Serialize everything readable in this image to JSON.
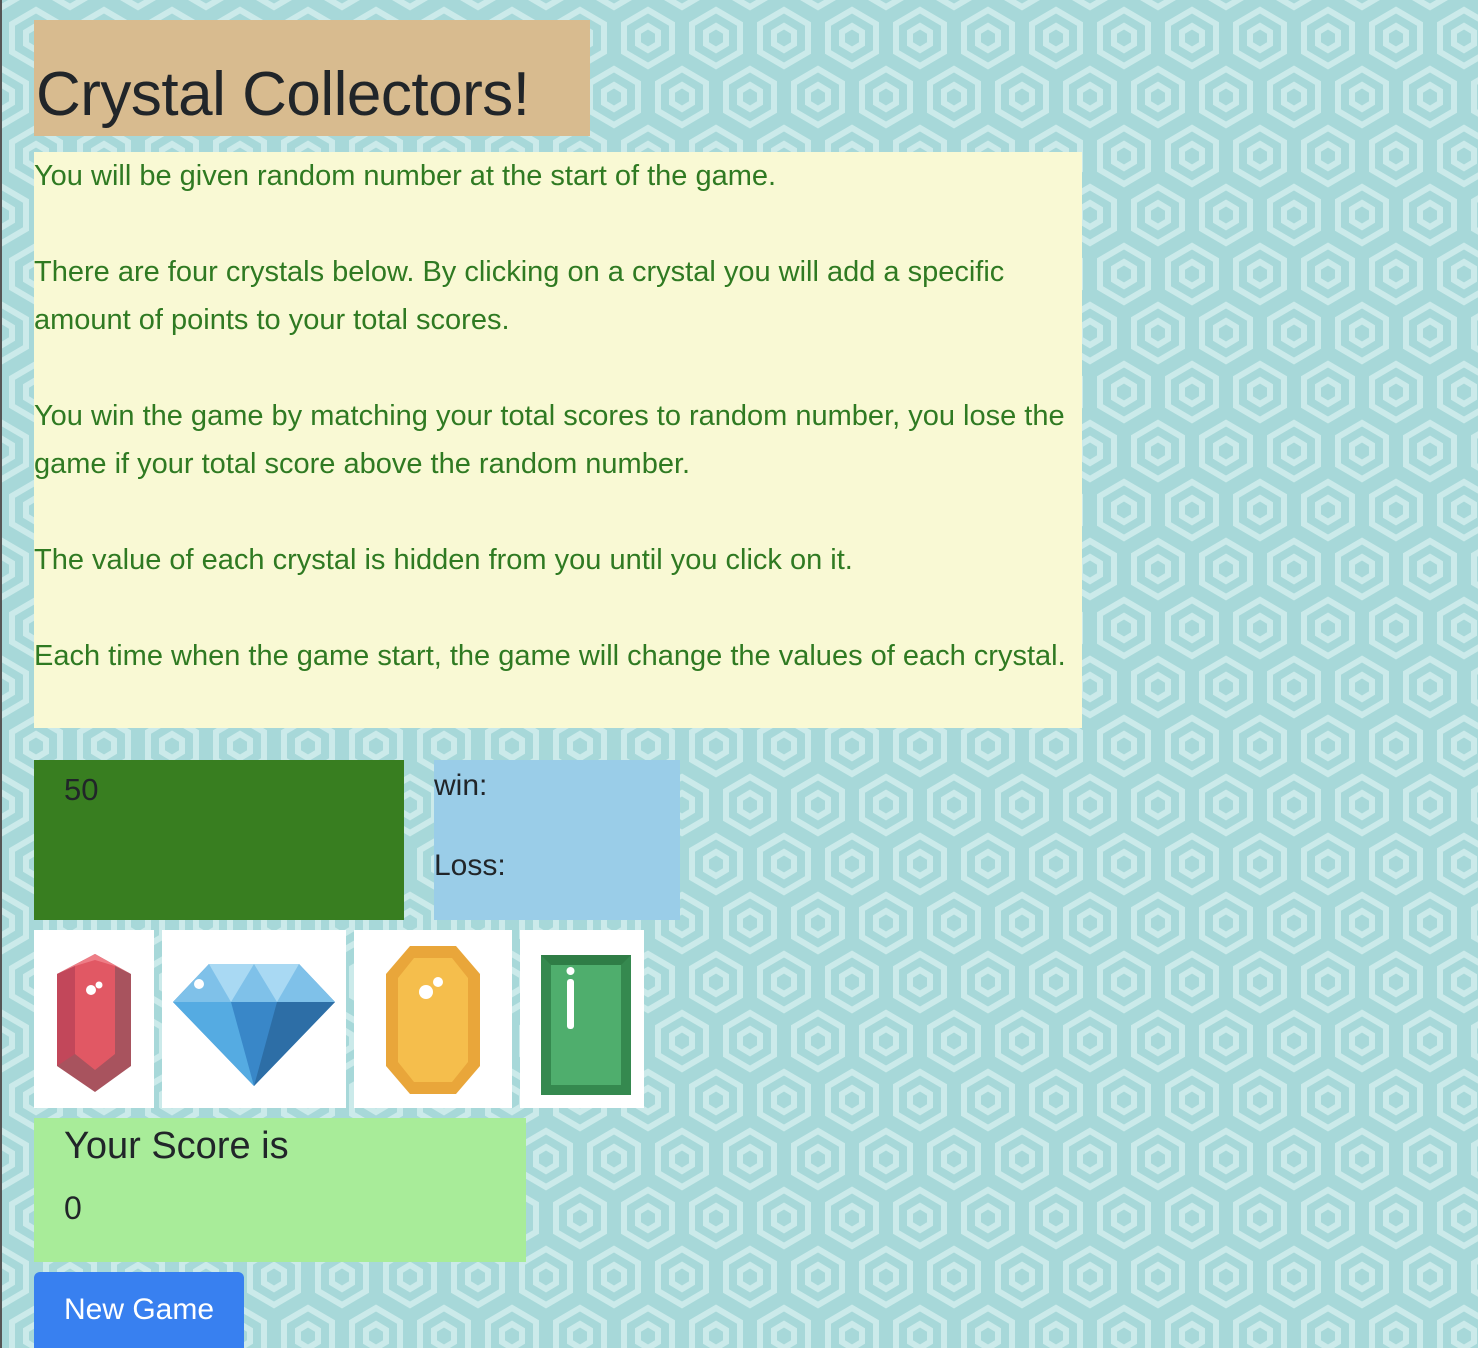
{
  "page": {
    "title": "Crystal Collectors!"
  },
  "instructions": [
    "You will be given random number at the start of the game.",
    "There are four crystals below. By clicking on a crystal you will add a specific amount of points to your total scores.",
    "You win the game by matching your total scores to random number, you lose the game if your total score above the random number.",
    "The value of each crystal is hidden from you until you click on it.",
    "Each time when the game start, the game will change the values of each crystal."
  ],
  "random_number": "50",
  "stats": {
    "win_label": "win:",
    "loss_label": "Loss:"
  },
  "crystals": [
    {
      "icon": "red-crystal-icon",
      "color": "#d9525e"
    },
    {
      "icon": "blue-diamond-icon",
      "color": "#4aa6e0"
    },
    {
      "icon": "yellow-crystal-icon",
      "color": "#f1b94a"
    },
    {
      "icon": "green-crystal-icon",
      "color": "#3f9b5e"
    }
  ],
  "score": {
    "heading": "Your Score is",
    "value": "0"
  },
  "new_game_label": "New Game",
  "colors": {
    "title_bg": "#d8bb8f",
    "instructions_bg": "#f9f9d4",
    "instructions_text": "#2f7a22",
    "random_bg": "#387e20",
    "stats_bg": "#9acde8",
    "score_bg": "#a8ec99",
    "button_bg": "#3880f0",
    "page_bg": "#a7d8d9"
  }
}
